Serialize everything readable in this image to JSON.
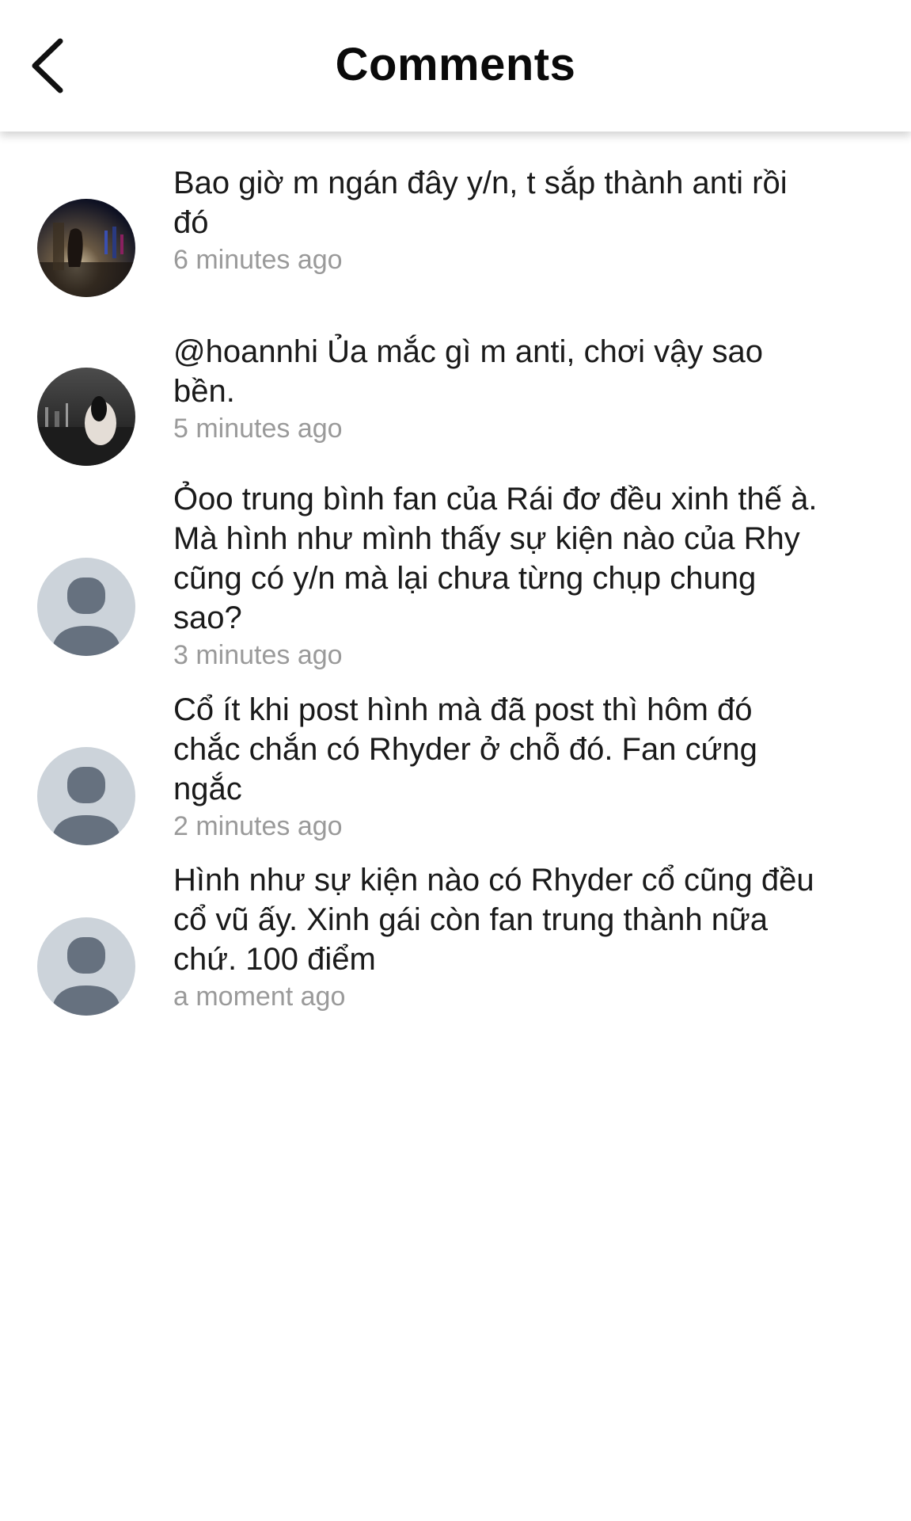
{
  "header": {
    "title": "Comments",
    "back_icon": "chevron-left-icon"
  },
  "comments": [
    {
      "avatar": "photo-avatar-city-night",
      "text": "Bao giờ m ngán đây y/n, t sắp thành anti rồi\nđó",
      "time": "6 minutes ago"
    },
    {
      "avatar": "photo-avatar-skyline",
      "text": "@hoannhi Ủa mắc gì m anti, chơi vậy sao\nbền.",
      "time": "5 minutes ago"
    },
    {
      "avatar": "default-user-icon",
      "text": "Ỏoo trung bình fan của Rái đơ đều xinh thế à.\nMà hình như mình thấy sự kiện nào của Rhy\ncũng có y/n mà lại chưa từng chụp chung\nsao?",
      "time": "3 minutes ago"
    },
    {
      "avatar": "default-user-icon",
      "text": "Cổ ít khi post hình mà đã post thì hôm đó\nchắc chắn có Rhyder ở chỗ đó. Fan cứng\nngắc",
      "time": "2 minutes ago"
    },
    {
      "avatar": "default-user-icon",
      "text": "Hình như sự kiện nào có Rhyder cổ cũng đều\ncổ vũ ấy. Xinh gái còn fan trung thành nữa\nchứ. 100 điểm",
      "time": "a moment ago"
    }
  ],
  "colors": {
    "timestamp": "#9a9a9a",
    "default_avatar_bg": "#ccd3da",
    "default_avatar_fg": "#66717f"
  }
}
